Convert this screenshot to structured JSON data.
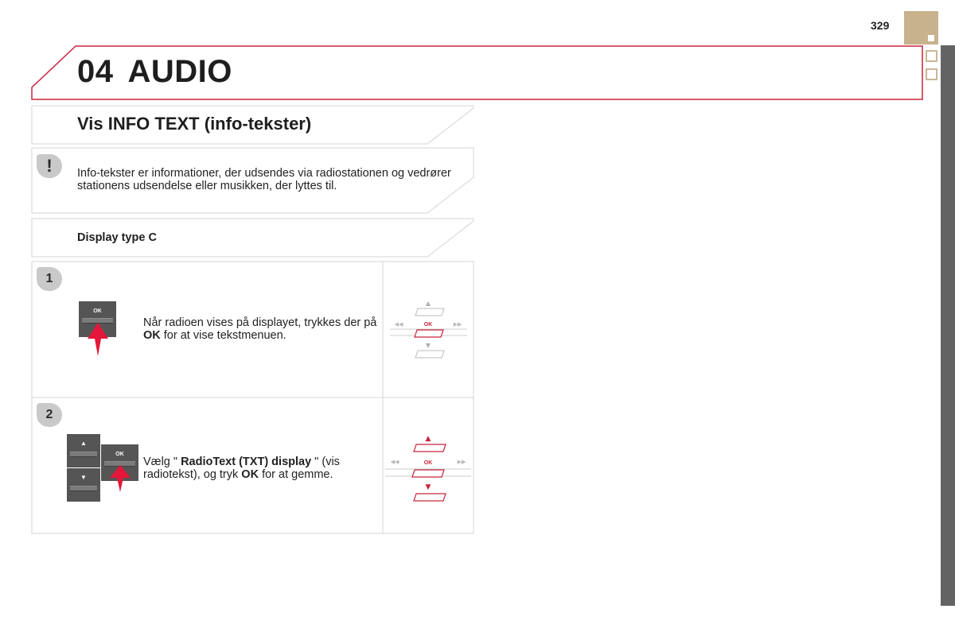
{
  "page": {
    "number": "329",
    "chapter_number": "04",
    "chapter_title": "AUDIO"
  },
  "colors": {
    "accent_red": "#c8233c",
    "tab_tan": "#c8b28c",
    "side_bar_grey": "#636363",
    "badge_grey": "#c9c9c9",
    "button_grey": "#555555"
  },
  "section": {
    "title": "Vis INFO TEXT (info-tekster)"
  },
  "note": {
    "icon": "exclamation-icon",
    "badge": "!",
    "text": "Info-tekster er informationer, der udsendes via radiostationen og vedrører stationens udsendelse eller musikken, der lyttes til."
  },
  "subsection": {
    "title": "Display type C"
  },
  "steps": [
    {
      "number": "1",
      "button_label": "OK",
      "text_pre": "Når radioen vises på displayet, trykkes der på ",
      "text_bold": "OK",
      "text_post": " for at vise tekstmenuen.",
      "diagram": {
        "up": "▲",
        "down": "▼",
        "left": "◂◂",
        "right": "▸▸",
        "center": "OK",
        "highlight": "center"
      }
    },
    {
      "number": "2",
      "button_label": "OK",
      "up_icon": "▲",
      "down_icon": "▼",
      "text_pre": "Vælg \" ",
      "text_bold": "RadioText (TXT) display",
      "text_mid": " \" (vis radiotekst), og tryk ",
      "text_bold2": "OK",
      "text_post": " for at gemme.",
      "diagram": {
        "up": "▲",
        "down": "▼",
        "left": "◂◂",
        "right": "▸▸",
        "center": "OK",
        "highlight": "all"
      }
    }
  ]
}
